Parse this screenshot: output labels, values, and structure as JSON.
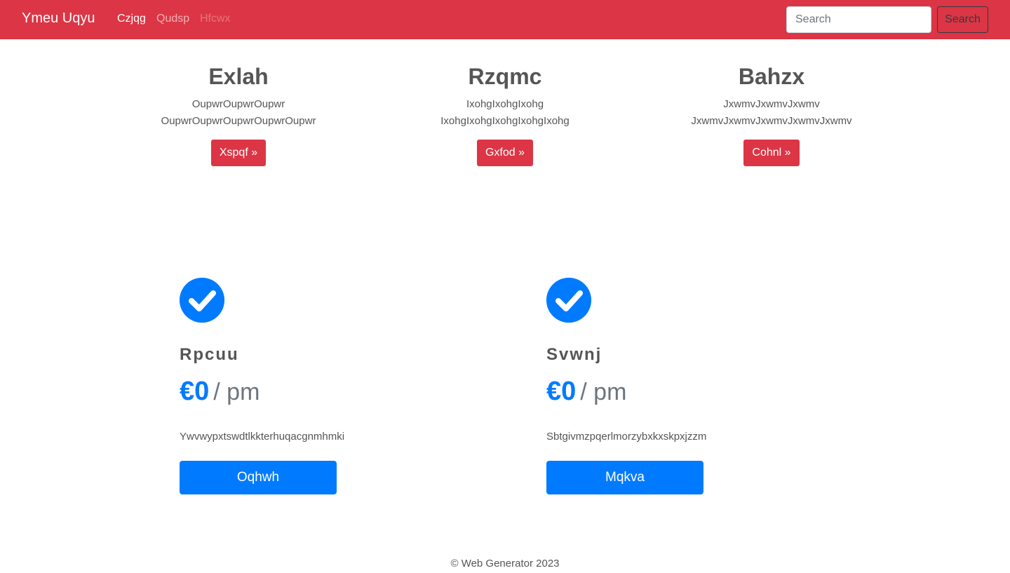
{
  "colors": {
    "navbar": "#dc3545",
    "accent": "#007bff",
    "text": "#555555"
  },
  "navbar": {
    "brand": "Ymeu Uqyu",
    "links": [
      {
        "label": "Czjqg",
        "state": "active"
      },
      {
        "label": "Qudsp",
        "state": "normal"
      },
      {
        "label": "Hfcwx",
        "state": "disabled"
      }
    ],
    "search": {
      "placeholder": "Search",
      "value": "",
      "button_label": "Search"
    }
  },
  "features": [
    {
      "title": "Exlah",
      "line1": "OupwrOupwrOupwr",
      "line2": "OupwrOupwrOupwrOupwrOupwr",
      "button": "Xspqf »"
    },
    {
      "title": "Rzqmc",
      "line1": "IxohgIxohgIxohg",
      "line2": "IxohgIxohgIxohgIxohgIxohg",
      "button": "Gxfod »"
    },
    {
      "title": "Bahzx",
      "line1": "JxwmvJxwmvJxwmv",
      "line2": "JxwmvJxwmvJxwmvJxwmvJxwmv",
      "button": "Cohnl »"
    }
  ],
  "plans": [
    {
      "icon": "check-circle-icon",
      "name": "Rpcuu",
      "price": "€0",
      "period": "/ pm",
      "description": "Ywvwypxtswdtlkkterhuqacgnmhmki",
      "button": "Oqhwh"
    },
    {
      "icon": "check-circle-icon",
      "name": "Svwnj",
      "price": "€0",
      "period": "/ pm",
      "description": "Sbtgivmzpqerlmorzybxkxskpxjzzm",
      "button": "Mqkva"
    }
  ],
  "footer": {
    "text": "© Web Generator 2023"
  }
}
